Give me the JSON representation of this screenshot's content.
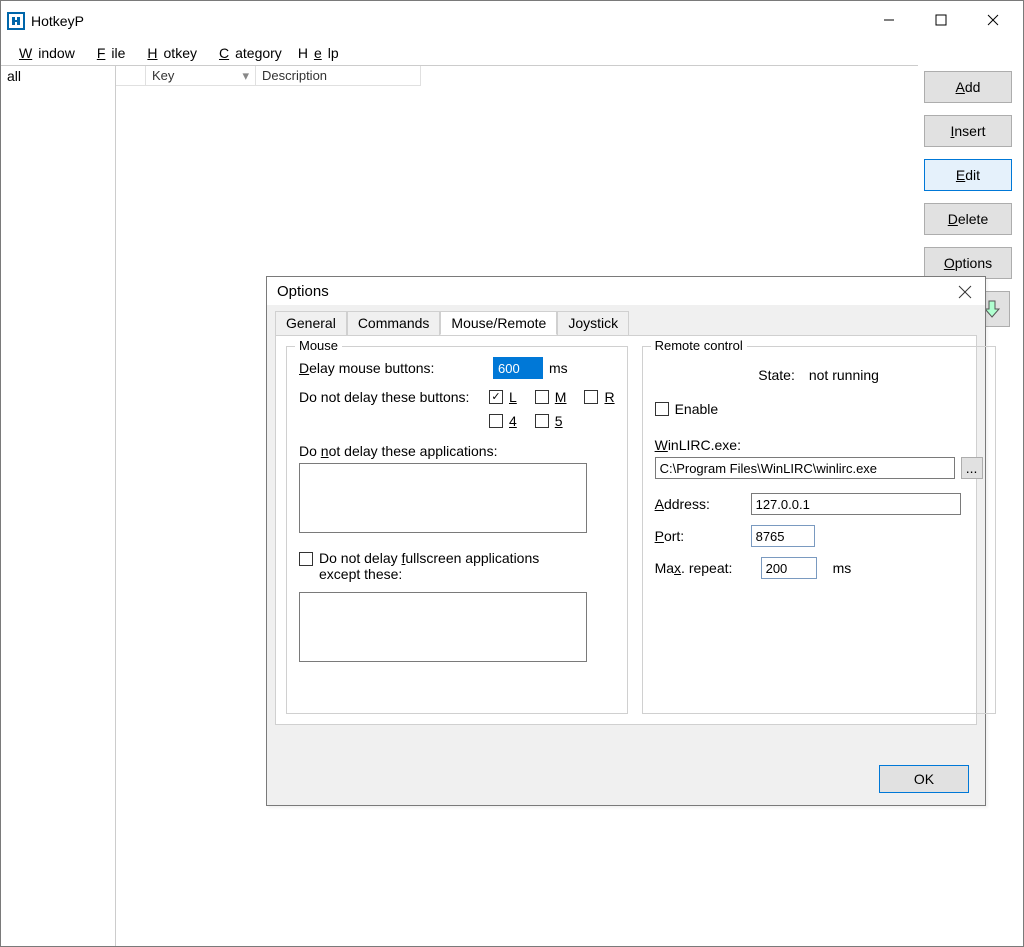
{
  "app": {
    "title": "HotkeyP"
  },
  "menu": {
    "window": "Window",
    "file": "File",
    "hotkey": "Hotkey",
    "category": "Category",
    "help": "Help"
  },
  "sidebar": {
    "item0": "all"
  },
  "columns": {
    "key": "Key",
    "description": "Description"
  },
  "buttons": {
    "add": "Add",
    "insert": "Insert",
    "edit": "Edit",
    "delete": "Delete",
    "options": "Options"
  },
  "dialog": {
    "title": "Options",
    "tabs": {
      "general": "General",
      "commands": "Commands",
      "mouse": "Mouse/Remote",
      "joystick": "Joystick"
    },
    "mouse": {
      "group": "Mouse",
      "delay_label": "Delay mouse buttons:",
      "delay_value": "600",
      "ms": "ms",
      "no_delay_buttons_label": "Do not delay these buttons:",
      "L": "L",
      "M": "M",
      "R": "R",
      "b4": "4",
      "b5": "5",
      "no_delay_apps_label": "Do not delay these applications:",
      "apps_value": "",
      "fullscreen_label1": "Do not delay fullscreen applications",
      "fullscreen_label2": "except these:",
      "fullscreen_apps_value": ""
    },
    "remote": {
      "group": "Remote control",
      "state_label": "State:",
      "state_value": "not running",
      "enable": "Enable",
      "winlirc_label": "WinLIRC.exe:",
      "winlirc_value": "C:\\Program Files\\WinLIRC\\winlirc.exe",
      "browse": "...",
      "address_label": "Address:",
      "address_value": "127.0.0.1",
      "port_label": "Port:",
      "port_value": "8765",
      "maxrepeat_label": "Max. repeat:",
      "maxrepeat_value": "200",
      "maxrepeat_ms": "ms"
    },
    "ok": "OK"
  }
}
